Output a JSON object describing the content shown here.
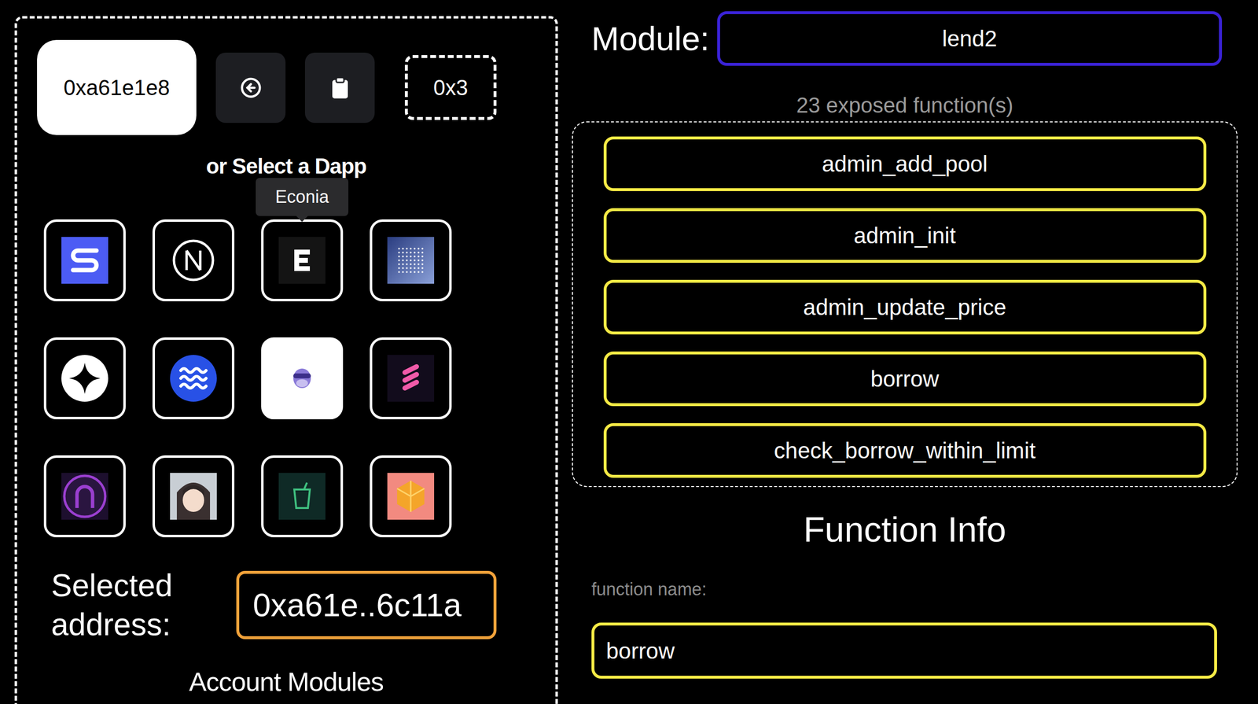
{
  "address_bar": {
    "input_value": "0xa61e1e8",
    "network": "0x3"
  },
  "dapp_picker": {
    "title": "or Select a Dapp",
    "tooltip": "Econia",
    "dapps": [
      {
        "kind": "s-logo",
        "hovered": false
      },
      {
        "kind": "n-logo",
        "hovered": false
      },
      {
        "kind": "e-logo",
        "hovered": true
      },
      {
        "kind": "dots",
        "hovered": false
      },
      {
        "kind": "star",
        "hovered": false
      },
      {
        "kind": "waves",
        "hovered": false
      },
      {
        "kind": "hippo",
        "hovered": false
      },
      {
        "kind": "stripes",
        "hovered": false
      },
      {
        "kind": "arch",
        "hovered": false
      },
      {
        "kind": "avatar",
        "hovered": false
      },
      {
        "kind": "cup",
        "hovered": false
      },
      {
        "kind": "gem",
        "hovered": false
      }
    ]
  },
  "selected_address": {
    "label": "Selected address:",
    "value": "0xa61e..6c11a"
  },
  "account_modules": {
    "title": "Account Modules"
  },
  "module": {
    "label": "Module:",
    "value": "lend2"
  },
  "functions": {
    "count_label": "23 exposed function(s)",
    "items": [
      "admin_add_pool",
      "admin_init",
      "admin_update_price",
      "borrow",
      "check_borrow_within_limit"
    ]
  },
  "function_info": {
    "title": "Function Info",
    "name_label": "function name:",
    "name_value": "borrow"
  }
}
